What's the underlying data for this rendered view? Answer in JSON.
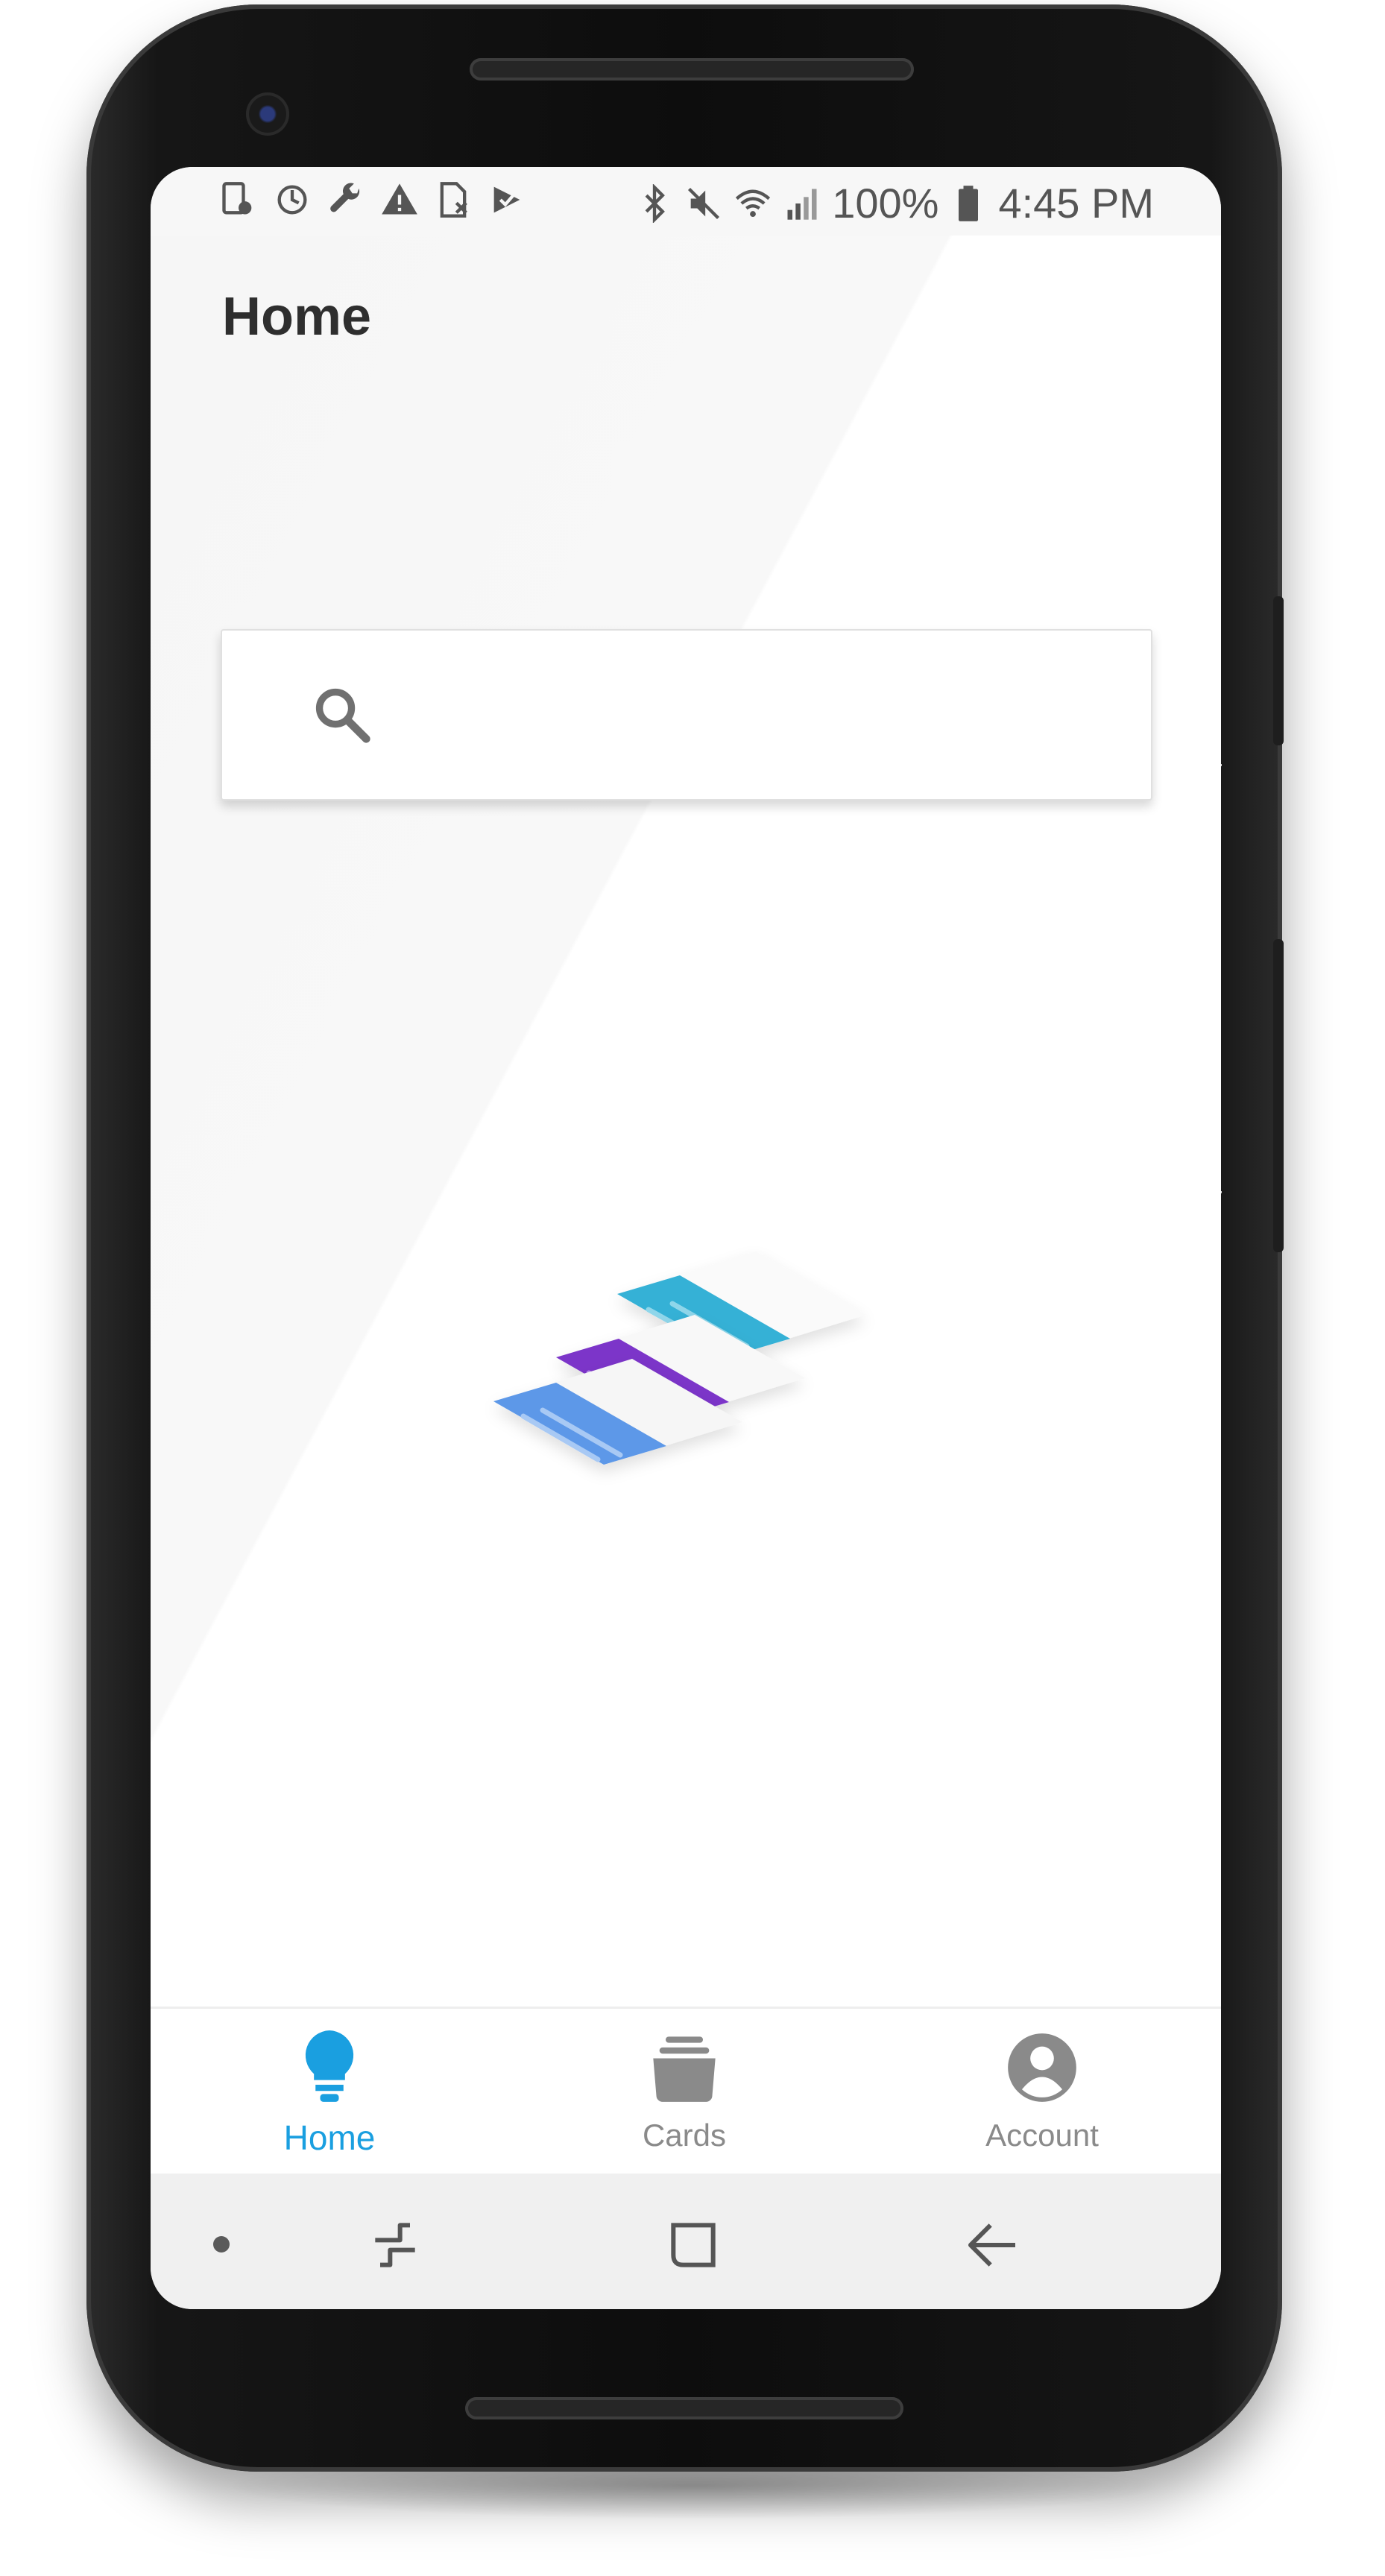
{
  "status_bar": {
    "battery": "100%",
    "time": "4:45 PM",
    "left_icons": [
      "screenshot-icon",
      "sync-icon",
      "wrench-icon",
      "warning-icon",
      "sim-off-icon",
      "task-check-icon"
    ],
    "right_icons": [
      "bluetooth-icon",
      "mute-icon",
      "wifi-icon",
      "signal-icon",
      "battery-icon"
    ]
  },
  "page": {
    "title": "Home"
  },
  "search": {
    "placeholder": "",
    "value": ""
  },
  "bottom_nav": {
    "items": [
      {
        "label": "Home",
        "icon": "lightbulb-icon",
        "active": true
      },
      {
        "label": "Cards",
        "icon": "cards-icon",
        "active": false
      },
      {
        "label": "Account",
        "icon": "account-icon",
        "active": false
      }
    ]
  },
  "system_nav": {
    "icons": [
      "dot-icon",
      "recents-icon",
      "home-icon",
      "back-icon"
    ]
  },
  "colors": {
    "accent": "#1a9fe0",
    "card_teal": "#36b1d6",
    "card_purple": "#7b35c9",
    "card_blue": "#5d98e8"
  }
}
